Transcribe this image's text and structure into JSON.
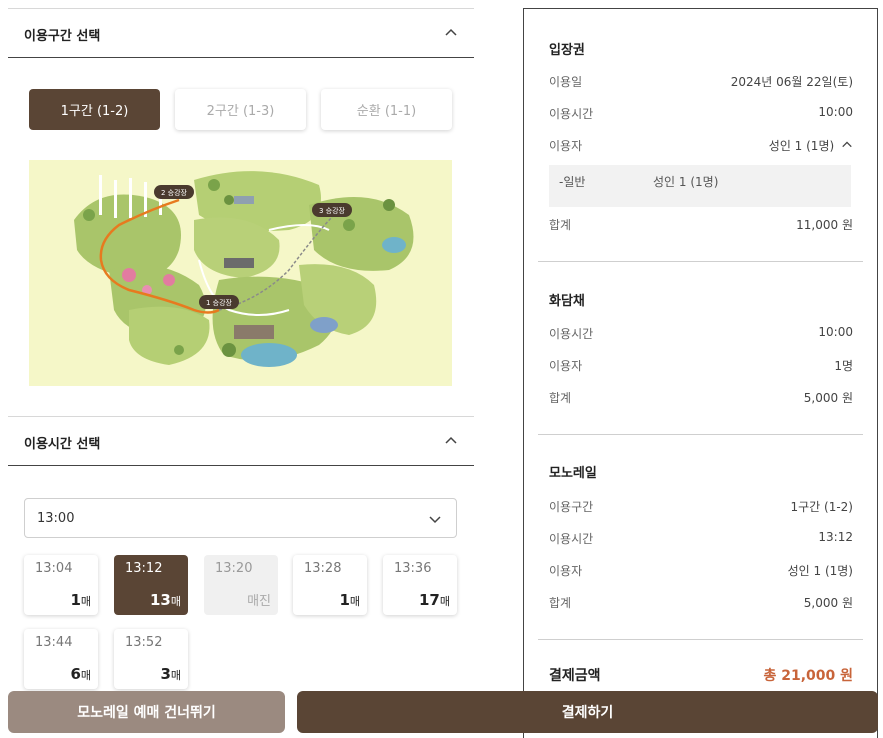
{
  "route_section": {
    "title": "이용구간 선택",
    "options": [
      {
        "label": "1구간 (1-2)",
        "active": true
      },
      {
        "label": "2구간 (1-3)",
        "active": false
      },
      {
        "label": "순환 (1-1)",
        "active": false
      }
    ],
    "map_labels": {
      "station1": "1 승강장",
      "station2": "2 승강장",
      "station3": "3 승강장"
    }
  },
  "time_section": {
    "title": "이용시간 선택",
    "selected_hour": "13:00",
    "slots": [
      {
        "time": "13:04",
        "count": "1",
        "unit": "매",
        "state": "normal"
      },
      {
        "time": "13:12",
        "count": "13",
        "unit": "매",
        "state": "selected"
      },
      {
        "time": "13:20",
        "count": "매진",
        "unit": "",
        "state": "soldout"
      },
      {
        "time": "13:28",
        "count": "1",
        "unit": "매",
        "state": "normal"
      },
      {
        "time": "13:36",
        "count": "17",
        "unit": "매",
        "state": "normal"
      },
      {
        "time": "13:44",
        "count": "6",
        "unit": "매",
        "state": "normal"
      },
      {
        "time": "13:52",
        "count": "3",
        "unit": "매",
        "state": "normal"
      }
    ]
  },
  "summary": {
    "ticket": {
      "title": "입장권",
      "date_label": "이용일",
      "date": "2024년 06월 22일(토)",
      "time_label": "이용시간",
      "time": "10:00",
      "user_label": "이용자",
      "user": "성인 1 (1명)",
      "detail_key": "-일반",
      "detail_val": "성인 1 (1명)",
      "sum_label": "합계",
      "sum": "11,000 원"
    },
    "hwadamchae": {
      "title": "화담채",
      "time_label": "이용시간",
      "time": "10:00",
      "user_label": "이용자",
      "user": "1명",
      "sum_label": "합계",
      "sum": "5,000 원"
    },
    "monorail": {
      "title": "모노레일",
      "route_label": "이용구간",
      "route": "1구간 (1-2)",
      "time_label": "이용시간",
      "time": "13:12",
      "user_label": "이용자",
      "user": "성인 1 (1명)",
      "sum_label": "합계",
      "sum": "5,000 원"
    },
    "total_label": "결제금액",
    "total": "총 21,000 원"
  },
  "buttons": {
    "skip": "모노레일 예매 건너뛰기",
    "pay": "결제하기"
  },
  "colors": {
    "brand": "#5a4535",
    "skip": "#9b8a80",
    "total": "#c8643a",
    "map_bg": "#f5f7c8"
  }
}
